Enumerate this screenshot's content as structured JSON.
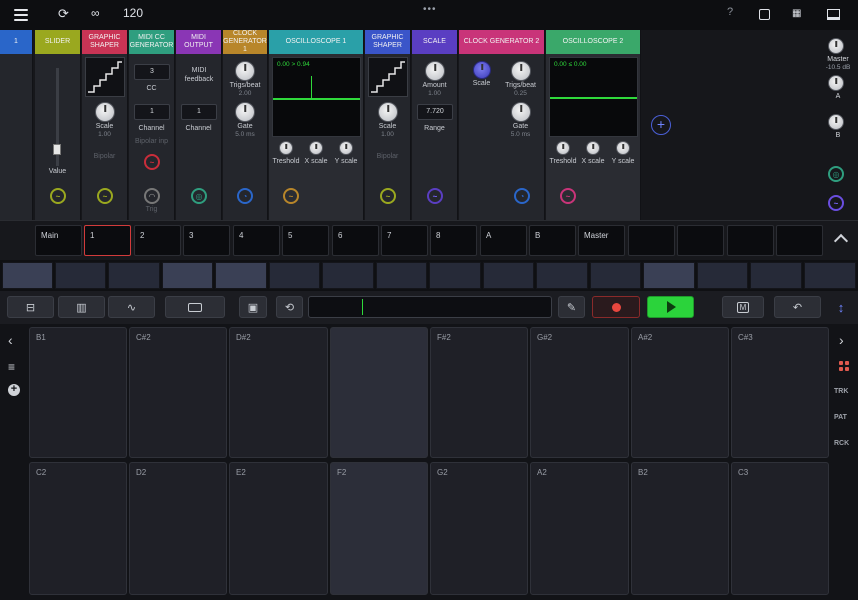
{
  "topbar": {
    "tempo": "120"
  },
  "modules": [
    {
      "id": "m1",
      "title": "1",
      "color": "#2a66c9"
    },
    {
      "id": "slider",
      "title": "SLIDER",
      "color": "#9aa81f",
      "value_label": "Value",
      "level": 0.17
    },
    {
      "id": "gs1",
      "title": "GRAPHIC SHAPER",
      "color": "#c93455",
      "param": "Scale",
      "param_value": "1.00",
      "mode": "Bipolar"
    },
    {
      "id": "midicc",
      "title": "MIDI CC GENERATOR",
      "color": "#2f9e7f",
      "ch1": "3",
      "cc_label": "CC",
      "ch2": "1",
      "channel_label": "Channel",
      "mode": "Bipolar inp",
      "trig": "Trig"
    },
    {
      "id": "midiout",
      "title": "MIDI OUTPUT",
      "color": "#8a36b5",
      "feedback": "MIDI feedback",
      "channel_value": "1",
      "channel_label": "Channel"
    },
    {
      "id": "clk1",
      "title": "CLOCK GENERATOR 1",
      "color": "#b8862a",
      "trigs_label": "Trigs/beat",
      "trigs_value": "2.00",
      "gate_label": "Gate",
      "gate_value": "5.0 ms"
    },
    {
      "id": "osc1",
      "title": "OSCILLOSCOPE 1",
      "color": "#2aa0a8",
      "readout": "0.00 > 0.94",
      "k1": "Treshold",
      "k2": "X scale",
      "k3": "Y scale"
    },
    {
      "id": "gs2",
      "title": "GRAPHIC SHAPER",
      "color": "#3a55c9",
      "param": "Scale",
      "param_value": "1.00",
      "mode": "Bipolar"
    },
    {
      "id": "scale",
      "title": "SCALE",
      "color": "#5a3ec2",
      "amount_label": "Amount",
      "amount_value": "1.00",
      "range_value": "7.720",
      "range_label": "Range"
    },
    {
      "id": "clk2",
      "title": "CLOCK GENERATOR 2",
      "color": "#c93479",
      "scale_label": "Scale",
      "trigs_label": "Trigs/beat",
      "trigs_value": "0.25",
      "gate_label": "Gate",
      "gate_value": "5.0 ms"
    },
    {
      "id": "osc2",
      "title": "OSCILLOSCOPE 2",
      "color": "#3aa86a",
      "readout": "0.00 ≤ 0.00",
      "k1": "Treshold",
      "k2": "X scale",
      "k3": "Y scale"
    }
  ],
  "master": {
    "label": "Master",
    "value": "-10.5 dB",
    "a": "A",
    "b": "B"
  },
  "tracks": [
    "Main",
    "1",
    "2",
    "3",
    "4",
    "5",
    "6",
    "7",
    "8",
    "A",
    "B",
    "Master",
    "",
    "",
    "",
    ""
  ],
  "transport": {
    "m_label": "M"
  },
  "pads_top": [
    "B1",
    "C#2",
    "D#2",
    "",
    "F#2",
    "G#2",
    "A#2",
    "C#3"
  ],
  "pads_bottom": [
    "C2",
    "D2",
    "E2",
    "F2",
    "G2",
    "A2",
    "B2",
    "C3"
  ],
  "side_right": {
    "trk": "TRK",
    "pat": "PAT",
    "rck": "RCK"
  }
}
